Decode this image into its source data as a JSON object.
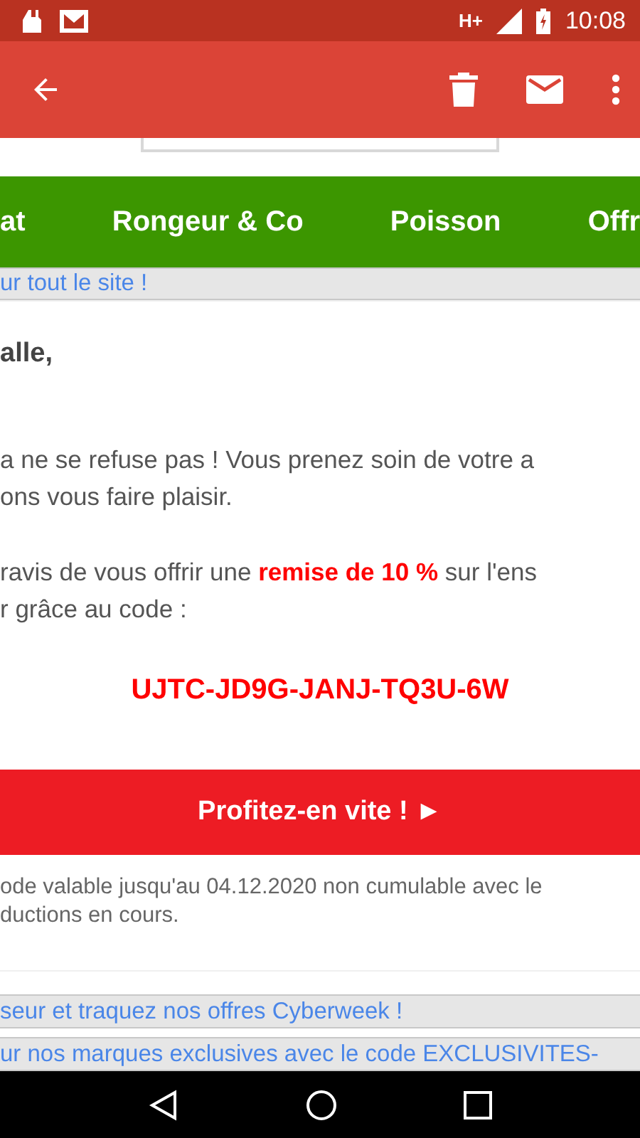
{
  "status_bar": {
    "network": "H+",
    "time": "10:08"
  },
  "nav_menu": [
    {
      "label": "at"
    },
    {
      "label": "Rongeur & Co"
    },
    {
      "label": "Poisson"
    },
    {
      "label": "Offr"
    }
  ],
  "top_banner": "ur tout le site !",
  "greeting": "alle,",
  "paragraphs": [
    [
      "a ne se refuse pas ! Vous prenez soin de votre a",
      "ons vous faire plaisir."
    ],
    [
      "ravis de vous offrir une **remise de 10 %** sur l'ens",
      "r grâce au code :"
    ]
  ],
  "promo_code": "UJTC-JD9G-JANJ-TQ3U-6W",
  "cta_button": "Profitez-en vite ! ►",
  "footnote": [
    "ode valable jusqu'au 04.12.2020 non cumulable avec le",
    "ductions en cours."
  ],
  "bottom_banners": [
    "seur et traquez nos offres Cyberweek !",
    "ur nos marques exclusives avec le code EXCLUSIVITES-"
  ]
}
